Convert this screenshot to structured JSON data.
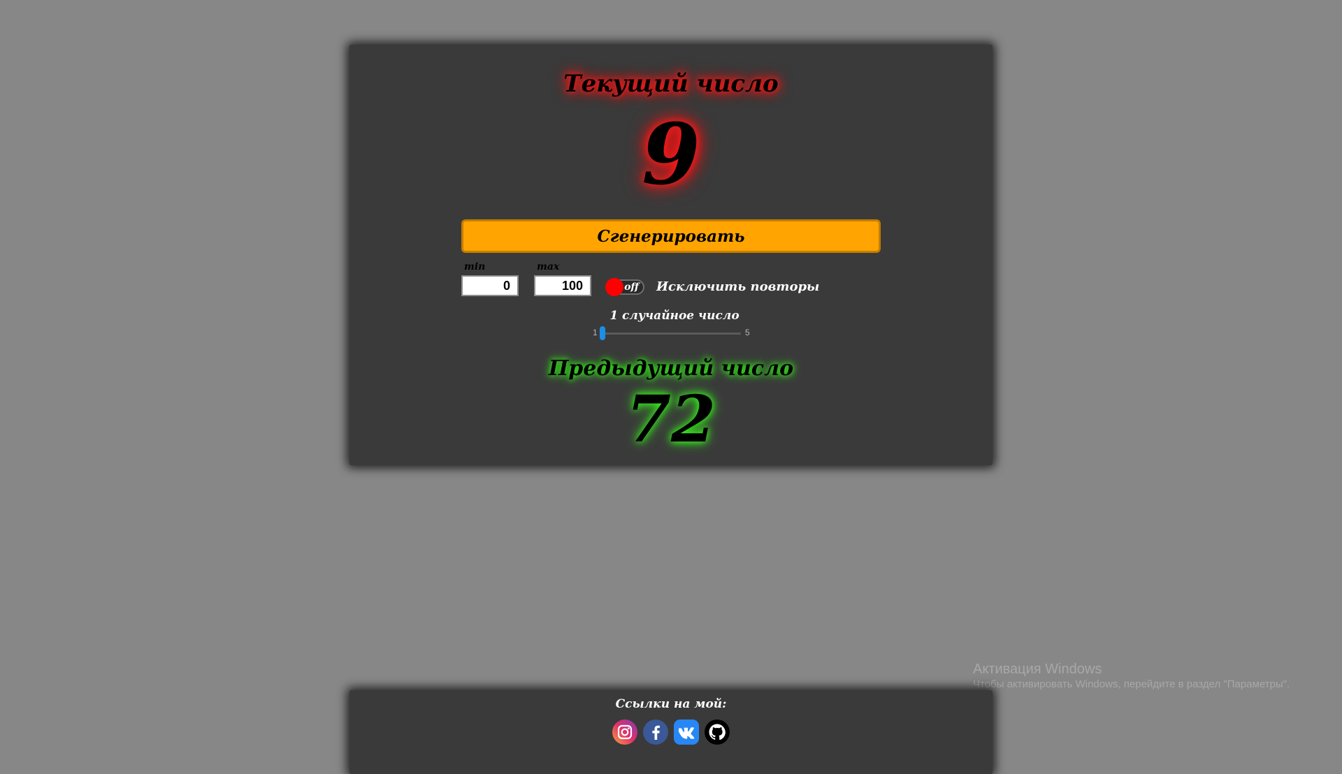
{
  "generator": {
    "current_title": "Текущий число",
    "current_value": "9",
    "generate_label": "Сгенерировать",
    "min_label": "min",
    "max_label": "max",
    "min_value": "0",
    "max_value": "100",
    "toggle_state": "off",
    "exclude_repeats_label": "Исключить повторы",
    "count_label": "1 случайное число",
    "count_slider": {
      "min": "1",
      "max": "5",
      "value": 1
    },
    "previous_title": "Предыдущий число",
    "previous_value": "72"
  },
  "footer": {
    "title": "Ссылки на мой:",
    "links": [
      "instagram-icon",
      "facebook-icon",
      "vk-icon",
      "github-icon"
    ]
  },
  "watermark": {
    "title": "Активация Windows",
    "text": "Чтобы активировать Windows, перейдите в раздел \"Параметры\"."
  },
  "colors": {
    "background": "#878787",
    "card": "#3a3a3a",
    "button": "#ffa400",
    "current_glow": "#ff1a1a",
    "previous_glow": "#37ff1a",
    "slider": "#1a8fe8",
    "toggle_knob": "#ff0000"
  }
}
